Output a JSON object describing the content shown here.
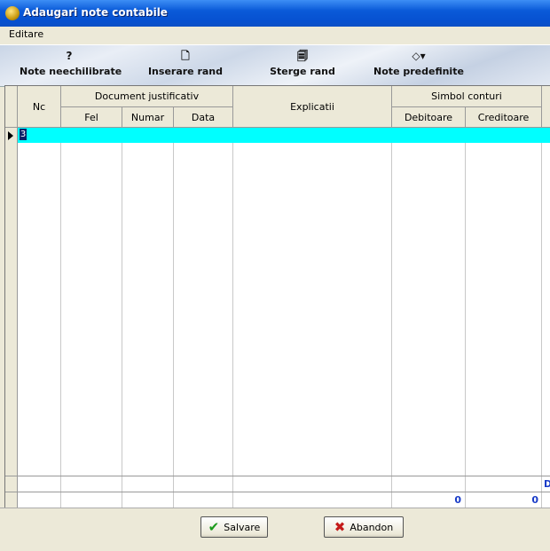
{
  "window": {
    "title": "Adaugari note contabile"
  },
  "menu": {
    "items": [
      "Editare"
    ]
  },
  "toolbar": {
    "buttons": [
      {
        "label": "Note neechilibrate",
        "glyph": "?"
      },
      {
        "label": "Inserare rand",
        "glyph": "🗋"
      },
      {
        "label": "Sterge rand",
        "glyph": "🗐"
      },
      {
        "label": "Note predefinite",
        "glyph": "◇▾"
      }
    ]
  },
  "grid": {
    "headers": {
      "nc": "Nc",
      "doc_group": "Document justificativ",
      "fel": "Fel",
      "numar": "Numar",
      "data": "Data",
      "explicatii": "Explicatii",
      "simbol_group": "Simbol conturi",
      "debitoare": "Debitoare",
      "creditoare": "Creditoare"
    },
    "rows": [
      {
        "nc": "3"
      }
    ],
    "totals": {
      "debit_label": "D",
      "debitoare": "0",
      "creditoare": "0"
    }
  },
  "footer": {
    "save_label": "Salvare",
    "cancel_label": "Abandon"
  },
  "colors": {
    "selected_row": "#00ffff",
    "total_text": "#1a3cc8",
    "title_bar": "#0a5ad8"
  }
}
